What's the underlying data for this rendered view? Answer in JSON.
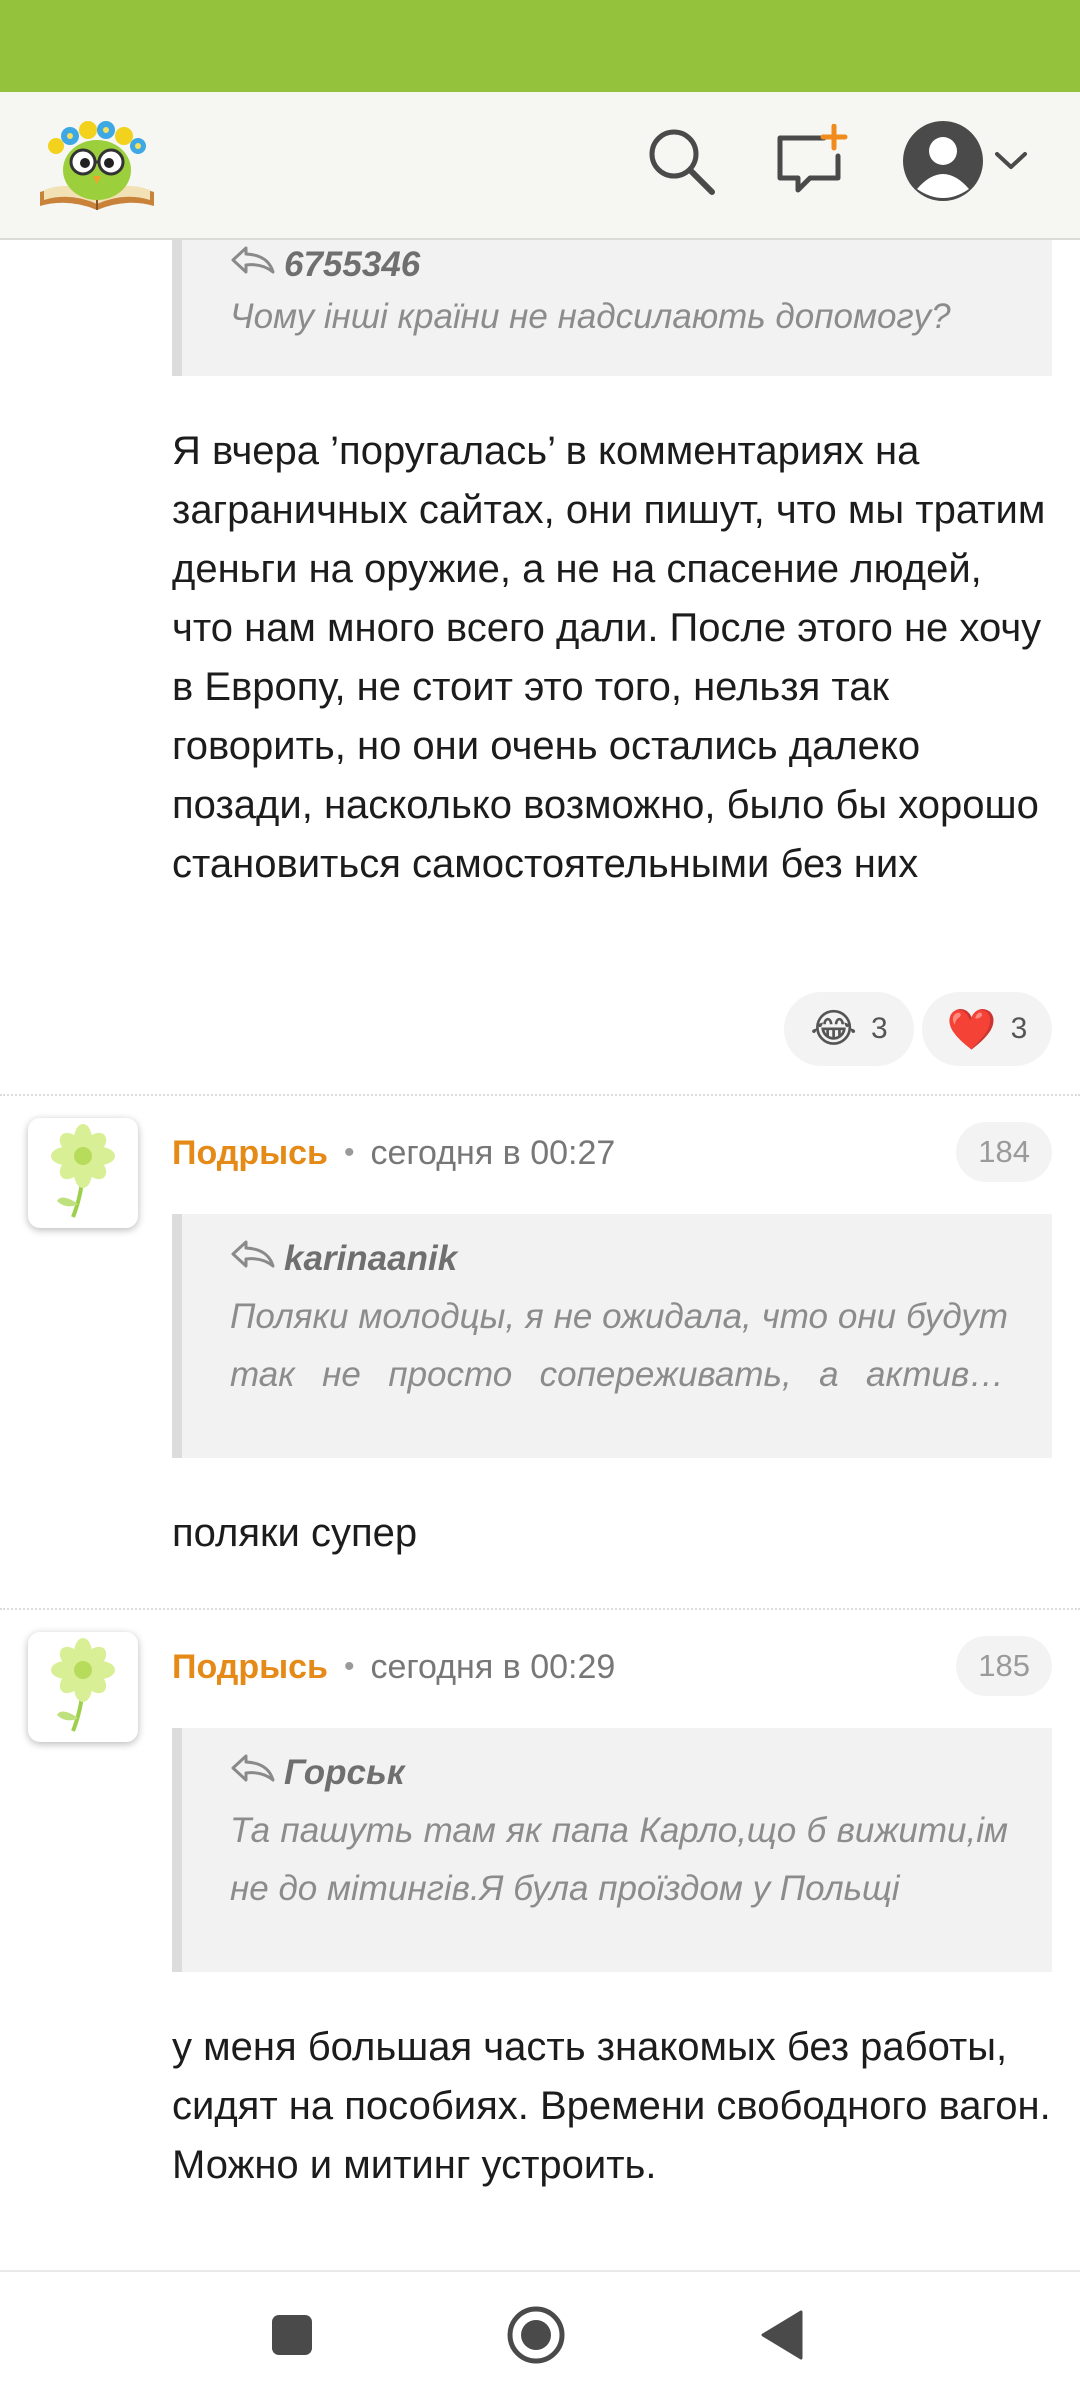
{
  "colors": {
    "status_bar": "#95c23d",
    "header_bg": "#f6f6f2",
    "author": "#e58a17",
    "quote_bg": "#f2f2f2"
  },
  "header": {
    "logo": "owl-with-flower-crown-on-book-logo",
    "icons": [
      "search-icon",
      "new-post-icon",
      "profile-icon",
      "chevron-down-icon"
    ]
  },
  "comments": [
    {
      "quote": {
        "author": "6755346",
        "text": "Чому інші країни не надсилають допомогу?"
      },
      "text": "Я вчера ’поругалась’ в комментариях на заграничных сайтах, они пишут, что мы тратим деньги на оружие, а не на спасение людей, что нам много всего дали. После этого не хочу в Европу, не стоит это того, нельзя так говорить, но они очень остались далеко позади, насколько возможно, было бы хорошо становиться самостоятельными без них",
      "reactions": [
        {
          "emoji": "😂",
          "icon": "tears-of-joy-emoji",
          "count": "3"
        },
        {
          "emoji": "❤️",
          "icon": "red-heart-emoji",
          "count": "3"
        }
      ]
    },
    {
      "author": "Подрысь",
      "separator": "•",
      "time": "сегодня в 00:27",
      "number": "184",
      "quote": {
        "author": "karinaanik",
        "text": "Поляки молодцы, я не ожидала, что они будут так не просто сопереживать, а активно помогать"
      },
      "text": "поляки супер"
    },
    {
      "author": "Подрысь",
      "separator": "•",
      "time": "сегодня в 00:29",
      "number": "185",
      "quote": {
        "author": "Горськ",
        "text": "Та пашуть там як папа Карло,що б вижити,ім не до мітингів.Я була проїздом у Польщі"
      },
      "text": "у меня большая часть знакомых без работы, сидят на пособиях. Времени свободного вагон. Можно и митинг устроить."
    }
  ],
  "nav": {
    "icons": [
      "recents-square-icon",
      "home-circle-icon",
      "back-triangle-icon"
    ]
  }
}
